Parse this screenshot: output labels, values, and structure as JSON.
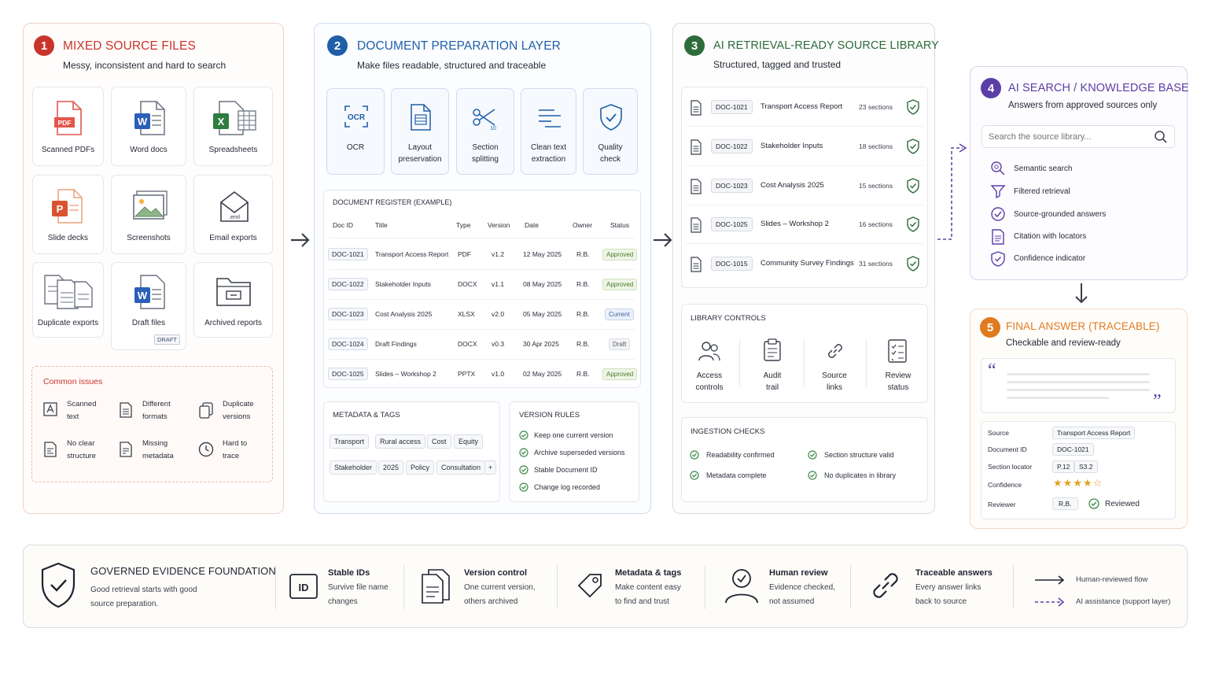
{
  "panel1": {
    "number": "1",
    "title": "MIXED SOURCE FILES",
    "subtitle": "Messy, inconsistent and hard to search",
    "cards": [
      {
        "label": "Scanned PDFs",
        "icon": "pdf-icon"
      },
      {
        "label": "Word docs",
        "icon": "word-icon"
      },
      {
        "label": "Spreadsheets",
        "icon": "excel-icon"
      },
      {
        "label": "Slide decks",
        "icon": "powerpoint-icon"
      },
      {
        "label": "Screenshots",
        "icon": "image-icon"
      },
      {
        "label": "Email exports",
        "icon": "email-icon"
      },
      {
        "label": "Duplicate exports",
        "icon": "duplicate-files-icon"
      },
      {
        "label": "Draft files",
        "icon": "word-draft-icon",
        "badge": "DRAFT"
      },
      {
        "label": "Archived reports",
        "icon": "archive-folder-icon"
      }
    ],
    "issues_title": "Common issues",
    "issues": [
      {
        "line1": "Scanned",
        "line2": "text"
      },
      {
        "line1": "Different",
        "line2": "formats"
      },
      {
        "line1": "Duplicate",
        "line2": "versions"
      },
      {
        "line1": "No clear",
        "line2": "structure"
      },
      {
        "line1": "Missing",
        "line2": "metadata"
      },
      {
        "line1": "Hard to",
        "line2": "trace"
      }
    ]
  },
  "panel2": {
    "number": "2",
    "title": "DOCUMENT PREPARATION LAYER",
    "subtitle": "Make files readable, structured and traceable",
    "steps": [
      {
        "line1": "OCR",
        "line2": "",
        "icon_text": "OCR"
      },
      {
        "line1": "Layout",
        "line2": "preservation"
      },
      {
        "line1": "Section",
        "line2": "splitting"
      },
      {
        "line1": "Clean text",
        "line2": "extraction"
      },
      {
        "line1": "Quality",
        "line2": "check"
      }
    ],
    "register": {
      "title": "DOCUMENT REGISTER (EXAMPLE)",
      "headers": [
        "Doc ID",
        "Title",
        "Type",
        "Version",
        "Date",
        "Owner",
        "Status"
      ],
      "rows": [
        {
          "id": "DOC-1021",
          "title": "Transport Access Report",
          "type": "PDF",
          "version": "v1.2",
          "date": "12 May 2025",
          "owner": "R.B.",
          "status": "Approved"
        },
        {
          "id": "DOC-1022",
          "title": "Stakeholder Inputs",
          "type": "DOCX",
          "version": "v1.1",
          "date": "08 May 2025",
          "owner": "R.B.",
          "status": "Approved"
        },
        {
          "id": "DOC-1023",
          "title": "Cost Analysis 2025",
          "type": "XLSX",
          "version": "v2.0",
          "date": "05 May 2025",
          "owner": "R.B.",
          "status": "Current"
        },
        {
          "id": "DOC-1024",
          "title": "Draft Findings",
          "type": "DOCX",
          "version": "v0.3",
          "date": "30 Apr 2025",
          "owner": "R.B.",
          "status": "Draft"
        },
        {
          "id": "DOC-1025",
          "title": "Slides – Workshop 2",
          "type": "PPTX",
          "version": "v1.0",
          "date": "02 May 2025",
          "owner": "R.B.",
          "status": "Approved"
        }
      ]
    },
    "metadata": {
      "title": "METADATA & TAGS",
      "row1": [
        "Transport",
        "Rural access",
        "Cost",
        "Equity"
      ],
      "row2": [
        "Stakeholder",
        "2025",
        "Policy",
        "Consultation",
        "+"
      ]
    },
    "version_rules": {
      "title": "VERSION RULES",
      "items": [
        "Keep one current version",
        "Archive superseded versions",
        "Stable Document ID",
        "Change log recorded"
      ]
    }
  },
  "panel3": {
    "number": "3",
    "title": "AI RETRIEVAL-READY SOURCE LIBRARY",
    "subtitle": "Structured, tagged and trusted",
    "library": [
      {
        "id": "DOC-1021",
        "title": "Transport Access Report",
        "sections": "23 sections"
      },
      {
        "id": "DOC-1022",
        "title": "Stakeholder Inputs",
        "sections": "18 sections"
      },
      {
        "id": "DOC-1023",
        "title": "Cost Analysis 2025",
        "sections": "15 sections"
      },
      {
        "id": "DOC-1025",
        "title": "Slides – Workshop 2",
        "sections": "16 sections"
      },
      {
        "id": "DOC-1015",
        "title": "Community Survey Findings",
        "sections": "31 sections"
      }
    ],
    "controls": {
      "title": "LIBRARY CONTROLS",
      "items": [
        {
          "line1": "Access",
          "line2": "controls"
        },
        {
          "line1": "Audit",
          "line2": "trail"
        },
        {
          "line1": "Source",
          "line2": "links"
        },
        {
          "line1": "Review",
          "line2": "status"
        }
      ]
    },
    "checks": {
      "title": "INGESTION CHECKS",
      "items": [
        "Readability confirmed",
        "Section structure valid",
        "Metadata complete",
        "No duplicates in library"
      ]
    }
  },
  "panel4": {
    "number": "4",
    "title": "AI SEARCH / KNOWLEDGE BASE",
    "subtitle": "Answers from approved sources only",
    "search_placeholder": "Search the source library...",
    "features": [
      "Semantic search",
      "Filtered retrieval",
      "Source-grounded answers",
      "Citation with locators",
      "Confidence indicator"
    ]
  },
  "panel5": {
    "number": "5",
    "title": "FINAL ANSWER (TRACEABLE)",
    "subtitle": "Checkable and review-ready",
    "open_quote": "“",
    "close_quote": "”",
    "fields": {
      "source_label": "Source",
      "source_value": "Transport Access Report",
      "docid_label": "Document ID",
      "docid_value": "DOC-1021",
      "locator_label": "Section locator",
      "locator_page": "P.12",
      "locator_section": "S3.2",
      "confidence_label": "Confidence",
      "confidence_stars": 4,
      "confidence_max": 5,
      "reviewer_label": "Reviewer",
      "reviewer_value": "R.B.",
      "reviewed_text": "Reviewed"
    }
  },
  "footer": {
    "title": "GOVERNED EVIDENCE FOUNDATION",
    "line1": "Good retrieval starts with good",
    "line2": "source preparation.",
    "items": [
      {
        "title": "Stable IDs",
        "line1": "Survive file name",
        "line2": "changes",
        "icon": "id-icon",
        "icon_text": "ID"
      },
      {
        "title": "Version control",
        "line1": "One current version,",
        "line2": "others archived",
        "icon": "stacked-docs-icon"
      },
      {
        "title": "Metadata & tags",
        "line1": "Make content easy",
        "line2": "to find and trust",
        "icon": "tag-icon"
      },
      {
        "title": "Human review",
        "line1": "Evidence checked,",
        "line2": "not assumed",
        "icon": "person-check-icon"
      },
      {
        "title": "Traceable answers",
        "line1": "Every answer links",
        "line2": "back to source",
        "icon": "chain-link-icon"
      }
    ],
    "legend": {
      "solid": "Human-reviewed flow",
      "dashed": "AI assistance (support layer)"
    }
  },
  "colors": {
    "red": "#c9342a",
    "blue": "#1f5fa8",
    "green": "#2e6b3a",
    "purple": "#5b3ea6",
    "orange": "#e07a1f",
    "check_green": "#3f8a4a"
  }
}
